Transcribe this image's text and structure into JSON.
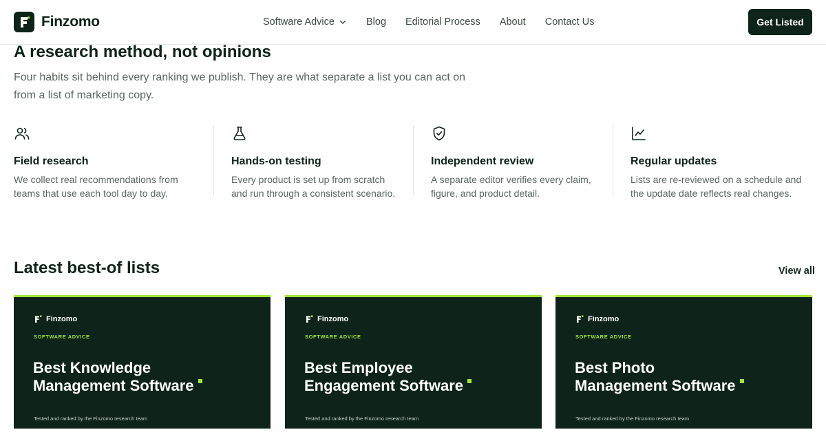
{
  "brand": {
    "name": "Finzomo"
  },
  "nav": {
    "items": [
      {
        "label": "Software Advice",
        "has_dropdown": true
      },
      {
        "label": "Blog"
      },
      {
        "label": "Editorial Process"
      },
      {
        "label": "About"
      },
      {
        "label": "Contact Us"
      }
    ],
    "cta_label": "Get Listed"
  },
  "research": {
    "title": "A research method, not opinions",
    "description": "Four habits sit behind every ranking we publish. They are what separate a list you can act on from a list of marketing copy.",
    "features": [
      {
        "icon": "users-icon",
        "title": "Field research",
        "description": "We collect real recommendations from teams that use each tool day to day."
      },
      {
        "icon": "flask-icon",
        "title": "Hands-on testing",
        "description": "Every product is set up from scratch and run through a consistent scenario."
      },
      {
        "icon": "shield-check-icon",
        "title": "Independent review",
        "description": "A separate editor verifies every claim, figure, and product detail."
      },
      {
        "icon": "line-chart-icon",
        "title": "Regular updates",
        "description": "Lists are re-reviewed on a schedule and the update date reflects real changes."
      }
    ]
  },
  "lists": {
    "title": "Latest best-of lists",
    "view_all": "View all",
    "cards": [
      {
        "brand": "Finzomo",
        "kicker": "SOFTWARE ADVICE",
        "title_line1": "Best Knowledge",
        "title_line2": "Management Software",
        "footer": "Tested and ranked by the Finzomo research team"
      },
      {
        "brand": "Finzomo",
        "kicker": "SOFTWARE ADVICE",
        "title_line1": "Best Employee",
        "title_line2": "Engagement Software",
        "footer": "Tested and ranked by the Finzomo research team"
      },
      {
        "brand": "Finzomo",
        "kicker": "SOFTWARE ADVICE",
        "title_line1": "Best Photo",
        "title_line2": "Management Software",
        "footer": "Tested and ranked by the Finzomo research team"
      }
    ]
  },
  "colors": {
    "brand_dark": "#0e2319",
    "accent": "#a3e635"
  }
}
